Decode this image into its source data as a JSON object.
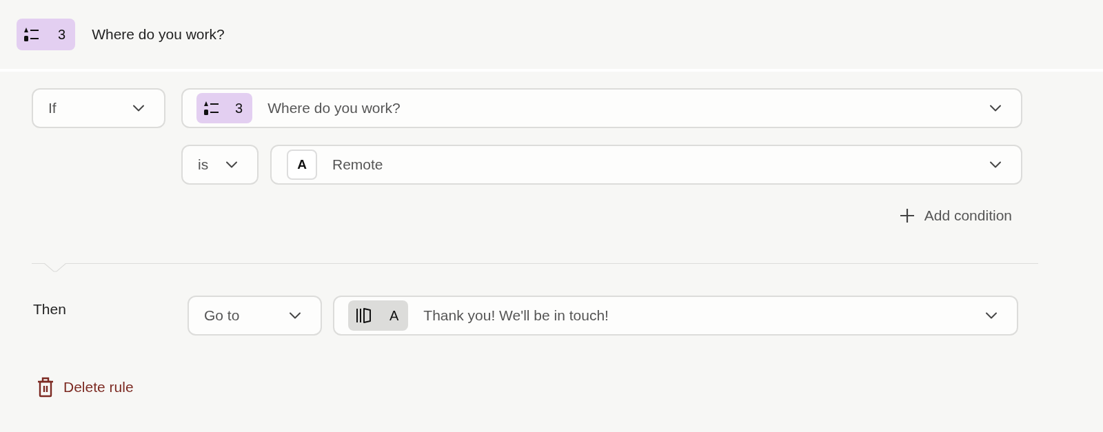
{
  "header": {
    "badge": {
      "kind": "question",
      "text": "3"
    },
    "title": "Where do you work?"
  },
  "rule": {
    "condition": {
      "operator": "If",
      "question": {
        "badge": {
          "kind": "question",
          "text": "3"
        },
        "text": "Where do you work?"
      },
      "comparator": "is",
      "value": {
        "badge": {
          "kind": "choice",
          "text": "A"
        },
        "text": "Remote"
      }
    },
    "add_condition": "Add condition",
    "action": {
      "label": "Then",
      "verb": "Go to",
      "target": {
        "badge": {
          "kind": "ending",
          "text": "A"
        },
        "text": "Thank you! We'll be in touch!"
      }
    },
    "delete": "Delete rule"
  }
}
